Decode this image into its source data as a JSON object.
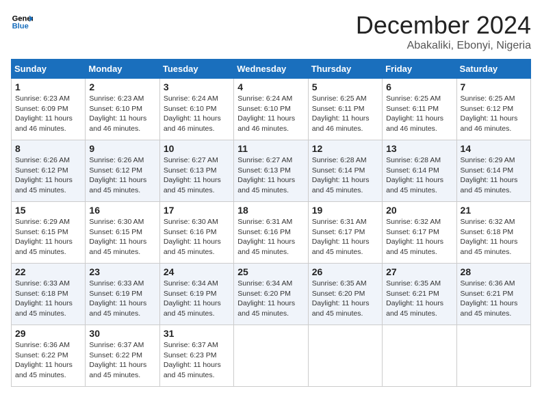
{
  "header": {
    "logo_line1": "General",
    "logo_line2": "Blue",
    "title": "December 2024",
    "subtitle": "Abakaliki, Ebonyi, Nigeria"
  },
  "days_of_week": [
    "Sunday",
    "Monday",
    "Tuesday",
    "Wednesday",
    "Thursday",
    "Friday",
    "Saturday"
  ],
  "weeks": [
    [
      {
        "day": 1,
        "info": "Sunrise: 6:23 AM\nSunset: 6:09 PM\nDaylight: 11 hours and 46 minutes."
      },
      {
        "day": 2,
        "info": "Sunrise: 6:23 AM\nSunset: 6:10 PM\nDaylight: 11 hours and 46 minutes."
      },
      {
        "day": 3,
        "info": "Sunrise: 6:24 AM\nSunset: 6:10 PM\nDaylight: 11 hours and 46 minutes."
      },
      {
        "day": 4,
        "info": "Sunrise: 6:24 AM\nSunset: 6:10 PM\nDaylight: 11 hours and 46 minutes."
      },
      {
        "day": 5,
        "info": "Sunrise: 6:25 AM\nSunset: 6:11 PM\nDaylight: 11 hours and 46 minutes."
      },
      {
        "day": 6,
        "info": "Sunrise: 6:25 AM\nSunset: 6:11 PM\nDaylight: 11 hours and 46 minutes."
      },
      {
        "day": 7,
        "info": "Sunrise: 6:25 AM\nSunset: 6:12 PM\nDaylight: 11 hours and 46 minutes."
      }
    ],
    [
      {
        "day": 8,
        "info": "Sunrise: 6:26 AM\nSunset: 6:12 PM\nDaylight: 11 hours and 45 minutes."
      },
      {
        "day": 9,
        "info": "Sunrise: 6:26 AM\nSunset: 6:12 PM\nDaylight: 11 hours and 45 minutes."
      },
      {
        "day": 10,
        "info": "Sunrise: 6:27 AM\nSunset: 6:13 PM\nDaylight: 11 hours and 45 minutes."
      },
      {
        "day": 11,
        "info": "Sunrise: 6:27 AM\nSunset: 6:13 PM\nDaylight: 11 hours and 45 minutes."
      },
      {
        "day": 12,
        "info": "Sunrise: 6:28 AM\nSunset: 6:14 PM\nDaylight: 11 hours and 45 minutes."
      },
      {
        "day": 13,
        "info": "Sunrise: 6:28 AM\nSunset: 6:14 PM\nDaylight: 11 hours and 45 minutes."
      },
      {
        "day": 14,
        "info": "Sunrise: 6:29 AM\nSunset: 6:14 PM\nDaylight: 11 hours and 45 minutes."
      }
    ],
    [
      {
        "day": 15,
        "info": "Sunrise: 6:29 AM\nSunset: 6:15 PM\nDaylight: 11 hours and 45 minutes."
      },
      {
        "day": 16,
        "info": "Sunrise: 6:30 AM\nSunset: 6:15 PM\nDaylight: 11 hours and 45 minutes."
      },
      {
        "day": 17,
        "info": "Sunrise: 6:30 AM\nSunset: 6:16 PM\nDaylight: 11 hours and 45 minutes."
      },
      {
        "day": 18,
        "info": "Sunrise: 6:31 AM\nSunset: 6:16 PM\nDaylight: 11 hours and 45 minutes."
      },
      {
        "day": 19,
        "info": "Sunrise: 6:31 AM\nSunset: 6:17 PM\nDaylight: 11 hours and 45 minutes."
      },
      {
        "day": 20,
        "info": "Sunrise: 6:32 AM\nSunset: 6:17 PM\nDaylight: 11 hours and 45 minutes."
      },
      {
        "day": 21,
        "info": "Sunrise: 6:32 AM\nSunset: 6:18 PM\nDaylight: 11 hours and 45 minutes."
      }
    ],
    [
      {
        "day": 22,
        "info": "Sunrise: 6:33 AM\nSunset: 6:18 PM\nDaylight: 11 hours and 45 minutes."
      },
      {
        "day": 23,
        "info": "Sunrise: 6:33 AM\nSunset: 6:19 PM\nDaylight: 11 hours and 45 minutes."
      },
      {
        "day": 24,
        "info": "Sunrise: 6:34 AM\nSunset: 6:19 PM\nDaylight: 11 hours and 45 minutes."
      },
      {
        "day": 25,
        "info": "Sunrise: 6:34 AM\nSunset: 6:20 PM\nDaylight: 11 hours and 45 minutes."
      },
      {
        "day": 26,
        "info": "Sunrise: 6:35 AM\nSunset: 6:20 PM\nDaylight: 11 hours and 45 minutes."
      },
      {
        "day": 27,
        "info": "Sunrise: 6:35 AM\nSunset: 6:21 PM\nDaylight: 11 hours and 45 minutes."
      },
      {
        "day": 28,
        "info": "Sunrise: 6:36 AM\nSunset: 6:21 PM\nDaylight: 11 hours and 45 minutes."
      }
    ],
    [
      {
        "day": 29,
        "info": "Sunrise: 6:36 AM\nSunset: 6:22 PM\nDaylight: 11 hours and 45 minutes."
      },
      {
        "day": 30,
        "info": "Sunrise: 6:37 AM\nSunset: 6:22 PM\nDaylight: 11 hours and 45 minutes."
      },
      {
        "day": 31,
        "info": "Sunrise: 6:37 AM\nSunset: 6:23 PM\nDaylight: 11 hours and 45 minutes."
      },
      null,
      null,
      null,
      null
    ]
  ]
}
